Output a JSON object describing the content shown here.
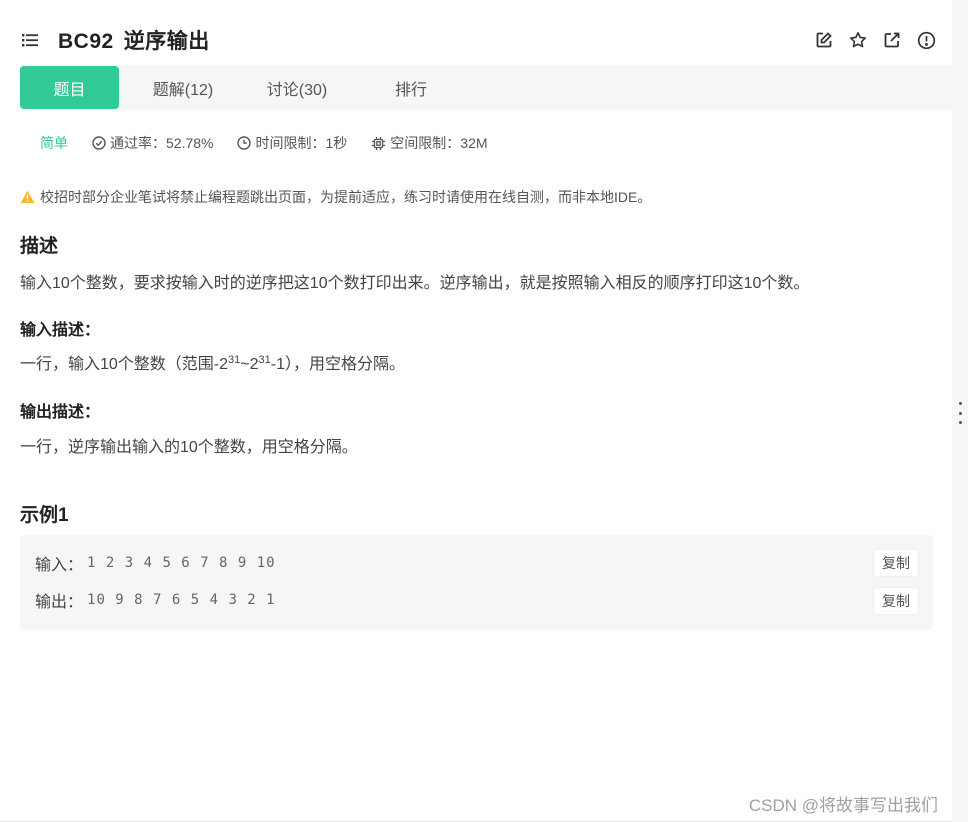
{
  "header": {
    "problem_id": "BC92",
    "problem_title": "逆序输出",
    "icons": [
      "list-icon",
      "edit-icon",
      "star-icon",
      "external-link-icon",
      "report-icon"
    ]
  },
  "tabs": [
    {
      "label": "题目",
      "active": true
    },
    {
      "label": "题解(12)",
      "active": false
    },
    {
      "label": "讨论(30)",
      "active": false
    },
    {
      "label": "排行",
      "active": false
    }
  ],
  "meta": {
    "difficulty": "简单",
    "pass_rate": "通过率：52.78%",
    "time_limit": "时间限制：1秒",
    "memory_limit": "空间限制：32M"
  },
  "warning": "校招时部分企业笔试将禁止编程题跳出页面，为提前适应，练习时请使用在线自测，而非本地IDE。",
  "description": {
    "heading": "描述",
    "text": "输入10个整数，要求按输入时的逆序把这10个数打印出来。逆序输出，就是按照输入相反的顺序打印这10个数。"
  },
  "input_desc": {
    "heading": "输入描述：",
    "text_a": "一行，输入10个整数（范围-2",
    "sup1": "31",
    "text_b": "~2",
    "sup2": "31",
    "text_c": "-1），用空格分隔。"
  },
  "output_desc": {
    "heading": "输出描述：",
    "text": "一行，逆序输出输入的10个整数，用空格分隔。"
  },
  "example": {
    "heading": "示例1",
    "input_label": "输入：",
    "input_value": "1 2 3 4 5 6 7 8 9 10",
    "output_label": "输出：",
    "output_value": "10 9 8 7 6 5 4 3 2 1",
    "copy_label": "复制"
  },
  "watermark": "CSDN @将故事写出我们",
  "colors": {
    "accent": "#32ca99",
    "warning": "#f5b82e",
    "tab_bg": "#f5f6f8"
  }
}
